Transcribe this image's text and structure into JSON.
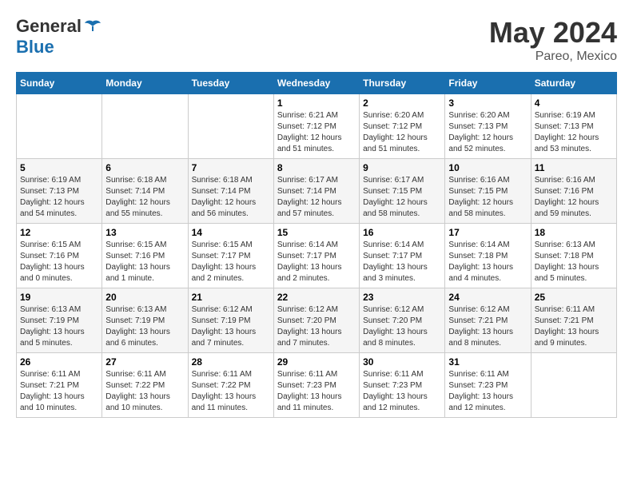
{
  "header": {
    "logo_general": "General",
    "logo_blue": "Blue",
    "month": "May 2024",
    "location": "Pareo, Mexico"
  },
  "days_of_week": [
    "Sunday",
    "Monday",
    "Tuesday",
    "Wednesday",
    "Thursday",
    "Friday",
    "Saturday"
  ],
  "weeks": [
    [
      {
        "day": "",
        "info": ""
      },
      {
        "day": "",
        "info": ""
      },
      {
        "day": "",
        "info": ""
      },
      {
        "day": "1",
        "info": "Sunrise: 6:21 AM\nSunset: 7:12 PM\nDaylight: 12 hours\nand 51 minutes."
      },
      {
        "day": "2",
        "info": "Sunrise: 6:20 AM\nSunset: 7:12 PM\nDaylight: 12 hours\nand 51 minutes."
      },
      {
        "day": "3",
        "info": "Sunrise: 6:20 AM\nSunset: 7:13 PM\nDaylight: 12 hours\nand 52 minutes."
      },
      {
        "day": "4",
        "info": "Sunrise: 6:19 AM\nSunset: 7:13 PM\nDaylight: 12 hours\nand 53 minutes."
      }
    ],
    [
      {
        "day": "5",
        "info": "Sunrise: 6:19 AM\nSunset: 7:13 PM\nDaylight: 12 hours\nand 54 minutes."
      },
      {
        "day": "6",
        "info": "Sunrise: 6:18 AM\nSunset: 7:14 PM\nDaylight: 12 hours\nand 55 minutes."
      },
      {
        "day": "7",
        "info": "Sunrise: 6:18 AM\nSunset: 7:14 PM\nDaylight: 12 hours\nand 56 minutes."
      },
      {
        "day": "8",
        "info": "Sunrise: 6:17 AM\nSunset: 7:14 PM\nDaylight: 12 hours\nand 57 minutes."
      },
      {
        "day": "9",
        "info": "Sunrise: 6:17 AM\nSunset: 7:15 PM\nDaylight: 12 hours\nand 58 minutes."
      },
      {
        "day": "10",
        "info": "Sunrise: 6:16 AM\nSunset: 7:15 PM\nDaylight: 12 hours\nand 58 minutes."
      },
      {
        "day": "11",
        "info": "Sunrise: 6:16 AM\nSunset: 7:16 PM\nDaylight: 12 hours\nand 59 minutes."
      }
    ],
    [
      {
        "day": "12",
        "info": "Sunrise: 6:15 AM\nSunset: 7:16 PM\nDaylight: 13 hours\nand 0 minutes."
      },
      {
        "day": "13",
        "info": "Sunrise: 6:15 AM\nSunset: 7:16 PM\nDaylight: 13 hours\nand 1 minute."
      },
      {
        "day": "14",
        "info": "Sunrise: 6:15 AM\nSunset: 7:17 PM\nDaylight: 13 hours\nand 2 minutes."
      },
      {
        "day": "15",
        "info": "Sunrise: 6:14 AM\nSunset: 7:17 PM\nDaylight: 13 hours\nand 2 minutes."
      },
      {
        "day": "16",
        "info": "Sunrise: 6:14 AM\nSunset: 7:17 PM\nDaylight: 13 hours\nand 3 minutes."
      },
      {
        "day": "17",
        "info": "Sunrise: 6:14 AM\nSunset: 7:18 PM\nDaylight: 13 hours\nand 4 minutes."
      },
      {
        "day": "18",
        "info": "Sunrise: 6:13 AM\nSunset: 7:18 PM\nDaylight: 13 hours\nand 5 minutes."
      }
    ],
    [
      {
        "day": "19",
        "info": "Sunrise: 6:13 AM\nSunset: 7:19 PM\nDaylight: 13 hours\nand 5 minutes."
      },
      {
        "day": "20",
        "info": "Sunrise: 6:13 AM\nSunset: 7:19 PM\nDaylight: 13 hours\nand 6 minutes."
      },
      {
        "day": "21",
        "info": "Sunrise: 6:12 AM\nSunset: 7:19 PM\nDaylight: 13 hours\nand 7 minutes."
      },
      {
        "day": "22",
        "info": "Sunrise: 6:12 AM\nSunset: 7:20 PM\nDaylight: 13 hours\nand 7 minutes."
      },
      {
        "day": "23",
        "info": "Sunrise: 6:12 AM\nSunset: 7:20 PM\nDaylight: 13 hours\nand 8 minutes."
      },
      {
        "day": "24",
        "info": "Sunrise: 6:12 AM\nSunset: 7:21 PM\nDaylight: 13 hours\nand 8 minutes."
      },
      {
        "day": "25",
        "info": "Sunrise: 6:11 AM\nSunset: 7:21 PM\nDaylight: 13 hours\nand 9 minutes."
      }
    ],
    [
      {
        "day": "26",
        "info": "Sunrise: 6:11 AM\nSunset: 7:21 PM\nDaylight: 13 hours\nand 10 minutes."
      },
      {
        "day": "27",
        "info": "Sunrise: 6:11 AM\nSunset: 7:22 PM\nDaylight: 13 hours\nand 10 minutes."
      },
      {
        "day": "28",
        "info": "Sunrise: 6:11 AM\nSunset: 7:22 PM\nDaylight: 13 hours\nand 11 minutes."
      },
      {
        "day": "29",
        "info": "Sunrise: 6:11 AM\nSunset: 7:23 PM\nDaylight: 13 hours\nand 11 minutes."
      },
      {
        "day": "30",
        "info": "Sunrise: 6:11 AM\nSunset: 7:23 PM\nDaylight: 13 hours\nand 12 minutes."
      },
      {
        "day": "31",
        "info": "Sunrise: 6:11 AM\nSunset: 7:23 PM\nDaylight: 13 hours\nand 12 minutes."
      },
      {
        "day": "",
        "info": ""
      }
    ]
  ]
}
